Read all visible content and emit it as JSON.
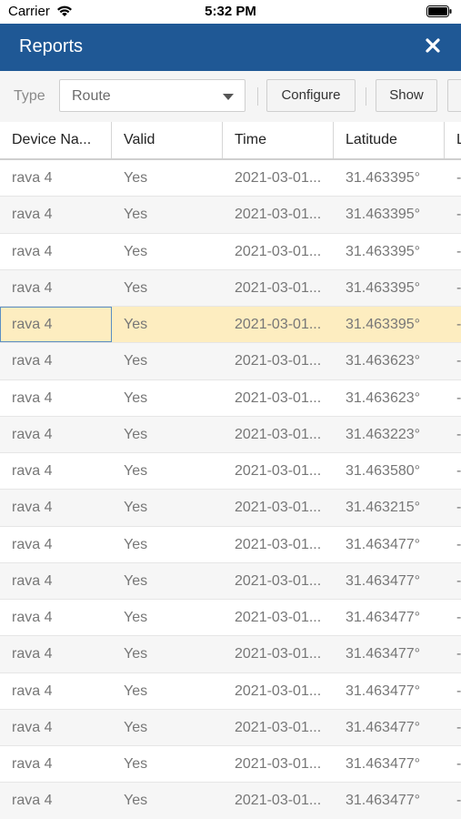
{
  "status_bar": {
    "carrier": "Carrier",
    "time": "5:32 PM"
  },
  "header": {
    "title": "Reports"
  },
  "toolbar": {
    "type_label": "Type",
    "type_value": "Route",
    "configure_label": "Configure",
    "show_label": "Show"
  },
  "table": {
    "columns": [
      "Device Na...",
      "Valid",
      "Time",
      "Latitude",
      "L"
    ],
    "rows": [
      [
        "rava 4",
        "Yes",
        "2021-03-01...",
        "31.463395°",
        "-"
      ],
      [
        "rava 4",
        "Yes",
        "2021-03-01...",
        "31.463395°",
        "-"
      ],
      [
        "rava 4",
        "Yes",
        "2021-03-01...",
        "31.463395°",
        "-"
      ],
      [
        "rava 4",
        "Yes",
        "2021-03-01...",
        "31.463395°",
        "-"
      ],
      [
        "rava 4",
        "Yes",
        "2021-03-01...",
        "31.463395°",
        "-"
      ],
      [
        "rava 4",
        "Yes",
        "2021-03-01...",
        "31.463623°",
        "-"
      ],
      [
        "rava 4",
        "Yes",
        "2021-03-01...",
        "31.463623°",
        "-"
      ],
      [
        "rava 4",
        "Yes",
        "2021-03-01...",
        "31.463223°",
        "-"
      ],
      [
        "rava 4",
        "Yes",
        "2021-03-01...",
        "31.463580°",
        "-"
      ],
      [
        "rava 4",
        "Yes",
        "2021-03-01...",
        "31.463215°",
        "-"
      ],
      [
        "rava 4",
        "Yes",
        "2021-03-01...",
        "31.463477°",
        "-"
      ],
      [
        "rava 4",
        "Yes",
        "2021-03-01...",
        "31.463477°",
        "-"
      ],
      [
        "rava 4",
        "Yes",
        "2021-03-01...",
        "31.463477°",
        "-"
      ],
      [
        "rava 4",
        "Yes",
        "2021-03-01...",
        "31.463477°",
        "-"
      ],
      [
        "rava 4",
        "Yes",
        "2021-03-01...",
        "31.463477°",
        "-"
      ],
      [
        "rava 4",
        "Yes",
        "2021-03-01...",
        "31.463477°",
        "-"
      ],
      [
        "rava 4",
        "Yes",
        "2021-03-01...",
        "31.463477°",
        "-"
      ],
      [
        "rava 4",
        "Yes",
        "2021-03-01...",
        "31.463477°",
        "-"
      ]
    ],
    "selected_row": 4
  },
  "colors": {
    "header_bg": "#1f5895",
    "selected_row_bg": "#fdedc0",
    "focus_border": "#5b8fc3"
  },
  "icons": {
    "wifi": "wifi-icon",
    "battery": "battery-icon",
    "close": "close-icon",
    "dropdown": "chevron-down-icon"
  }
}
